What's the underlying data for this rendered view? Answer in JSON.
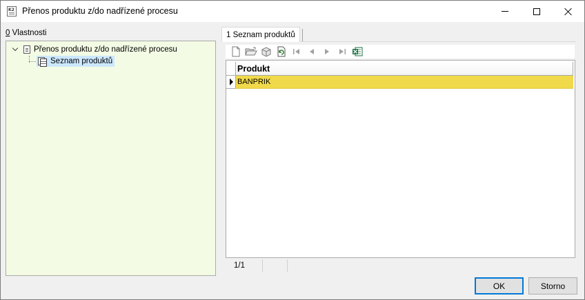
{
  "window": {
    "title": "Přenos produktu z/do nadřízené procesu"
  },
  "left_panel": {
    "label_accel": "0",
    "label_text": " Vlastnosti",
    "tree": {
      "root_label": "Přenos produktu z/do nadřízené procesu",
      "child_label": "Seznam produktů"
    }
  },
  "right_panel": {
    "tab_label": "1 Seznam produktů",
    "toolbar": [
      {
        "icon": "new-document-icon",
        "enabled": true
      },
      {
        "icon": "open-folder-icon",
        "enabled": true
      },
      {
        "icon": "box-icon",
        "enabled": true
      },
      {
        "icon": "refresh-document-icon",
        "enabled": true
      },
      {
        "icon": "first-record-icon",
        "enabled": false
      },
      {
        "icon": "previous-record-icon",
        "enabled": false
      },
      {
        "icon": "next-record-icon",
        "enabled": false
      },
      {
        "icon": "last-record-icon",
        "enabled": false
      },
      {
        "icon": "excel-export-icon",
        "enabled": true
      }
    ],
    "grid": {
      "columns": [
        "Produkt"
      ],
      "rows": [
        {
          "produkt": "BANPRIK",
          "selected": true
        }
      ],
      "highlight_color": "#f0d94a"
    },
    "status": {
      "count": "1/1"
    }
  },
  "buttons": {
    "ok": "OK",
    "cancel": "Storno"
  },
  "colors": {
    "tree_background": "#f3fbe4",
    "selection": "#cce8ff",
    "ok_border": "#0078d7"
  }
}
